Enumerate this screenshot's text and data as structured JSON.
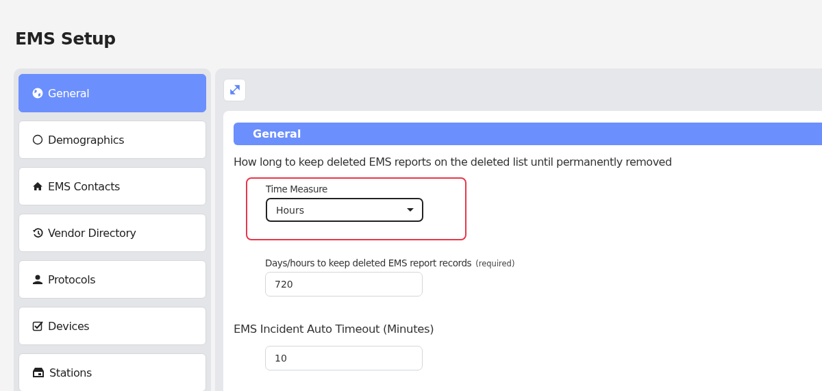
{
  "page_title": "EMS Setup",
  "sidebar": {
    "items": [
      {
        "label": "General",
        "selected": true
      },
      {
        "label": "Demographics",
        "selected": false
      },
      {
        "label": "EMS Contacts",
        "selected": false
      },
      {
        "label": "Vendor Directory",
        "selected": false
      },
      {
        "label": "Protocols",
        "selected": false
      },
      {
        "label": "Devices",
        "selected": false
      },
      {
        "label": "Stations",
        "selected": false
      }
    ]
  },
  "section": {
    "title": "General",
    "retention_question": "How long to keep deleted EMS reports on the deleted list until permanently removed",
    "time_measure": {
      "label": "Time Measure",
      "value": "Hours",
      "highlighted": true
    },
    "keep_records": {
      "label": "Days/hours to keep deleted EMS report records",
      "note": "(required)",
      "value": "720"
    },
    "timeout_heading": "EMS Incident Auto Timeout (Minutes)",
    "timeout": {
      "value": "10"
    }
  }
}
